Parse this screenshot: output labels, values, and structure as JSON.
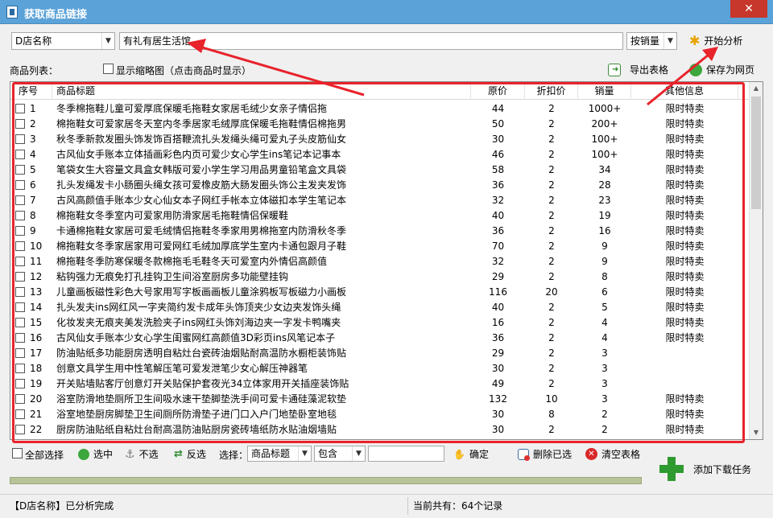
{
  "window": {
    "title": "获取商品链接",
    "close_glyph": "✕"
  },
  "search": {
    "shop_select": "D店名称",
    "keyword": "有礼有居生活馆",
    "sort_select": "按销量",
    "start_button": "开始分析"
  },
  "toolbar": {
    "list_label": "商品列表：",
    "thumb_checkbox_label": "显示缩略图（点击商品时显示）",
    "export_button": "导出表格",
    "save_web_button": "保存为网页"
  },
  "table": {
    "headers": [
      "序号",
      "商品标题",
      "原价",
      "折扣价",
      "销量",
      "其他信息"
    ],
    "rows": [
      [
        "1",
        "冬季棉拖鞋儿童可爱厚底保暖毛拖鞋女家居毛绒少女亲子情侣拖",
        "44",
        "2",
        "1000+",
        "限时特卖"
      ],
      [
        "2",
        "棉拖鞋女可爱家居冬天室内冬季居家毛绒厚底保暖毛拖鞋情侣棉拖男",
        "50",
        "2",
        "200+",
        "限时特卖"
      ],
      [
        "3",
        "秋冬季新款发圈头饰发饰百搭鞭流扎头发绳头绳可爱丸子头皮筋仙女",
        "30",
        "2",
        "100+",
        "限时特卖"
      ],
      [
        "4",
        "古风仙女手账本立体插画彩色内页可爱少女心学生ins笔记本记事本",
        "46",
        "2",
        "100+",
        "限时特卖"
      ],
      [
        "5",
        "笔袋女生大容量文具盒女韩版可爱小学生学习用品男童铅笔盒文具袋",
        "58",
        "2",
        "34",
        "限时特卖"
      ],
      [
        "6",
        "扎头发绳发卡小肠圈头绳女孩可爱橡皮筋大肠发圈头饰公主发夹发饰",
        "36",
        "2",
        "28",
        "限时特卖"
      ],
      [
        "7",
        "古风高颜值手账本少女心仙女本子网红手帐本立体磁扣本学生笔记本",
        "32",
        "2",
        "23",
        "限时特卖"
      ],
      [
        "8",
        "棉拖鞋女冬季室内可爱家用防滑家居毛拖鞋情侣保暖鞋",
        "40",
        "2",
        "19",
        "限时特卖"
      ],
      [
        "9",
        "卡通棉拖鞋女家居可爱毛绒情侣拖鞋冬季家用男棉拖室内防滑秋冬季",
        "36",
        "2",
        "16",
        "限时特卖"
      ],
      [
        "10",
        "棉拖鞋女冬季家居家用可爱网红毛绒加厚底学生室内卡通包跟月子鞋",
        "70",
        "2",
        "9",
        "限时特卖"
      ],
      [
        "11",
        "棉拖鞋冬季防寒保暖冬款棉拖毛毛鞋冬天可爱室内外情侣高颜值",
        "32",
        "2",
        "9",
        "限时特卖"
      ],
      [
        "12",
        "粘钩强力无痕免打孔挂钩卫生间浴室厨房多功能壁挂钩",
        "29",
        "2",
        "8",
        "限时特卖"
      ],
      [
        "13",
        "儿童画板磁性彩色大号家用写字板画画板儿童涂鸦板写板磁力小画板",
        "116",
        "20",
        "6",
        "限时特卖"
      ],
      [
        "14",
        "扎头发夫ins网红风一字夹简约发卡成年头饰顶夹少女边夹发饰头绳",
        "40",
        "2",
        "5",
        "限时特卖"
      ],
      [
        "15",
        "化妆发夹无痕夹美发洗脸夹子ins网红头饰刘海边夹一字发卡鸭嘴夹",
        "16",
        "2",
        "4",
        "限时特卖"
      ],
      [
        "16",
        "古风仙女手账本少女心学生闺蜜网红高颜值3D彩页ins风笔记本子",
        "36",
        "2",
        "4",
        "限时特卖"
      ],
      [
        "17",
        "防油贴纸多功能厨房透明自粘灶台瓷砖油烟贴耐高温防水橱柜装饰贴",
        "29",
        "2",
        "3",
        ""
      ],
      [
        "18",
        "创意文具学生用中性笔解压笔可爱发泄笔少女心解压神器笔",
        "30",
        "2",
        "3",
        ""
      ],
      [
        "19",
        "开关贴墙贴客厅创意灯开关贴保护套夜光34立体家用开关插座装饰贴",
        "49",
        "2",
        "3",
        ""
      ],
      [
        "20",
        "浴室防滑地垫厕所卫生间吸水速干垫脚垫洗手间可爱卡通硅藻泥软垫",
        "132",
        "10",
        "3",
        "限时特卖"
      ],
      [
        "21",
        "浴室地垫厨房脚垫卫生间厕所防滑垫子进门口入户门地垫卧室地毯",
        "30",
        "8",
        "2",
        "限时特卖"
      ],
      [
        "22",
        "厨房防油贴纸自粘灶台耐高温防油贴厨房瓷砖墙纸防水贴油烟墙贴",
        "30",
        "2",
        "2",
        "限时特卖"
      ]
    ]
  },
  "bottom": {
    "select_all": "全部选择",
    "select_button": "选中",
    "deselect_button": "不选",
    "invert_button": "反选",
    "choose_label": "选择：",
    "field_select": "商品标题",
    "mode_select": "包含",
    "filter_value": "",
    "confirm_button": "确定",
    "delete_selected_button": "删除已选",
    "clear_table_button": "清空表格",
    "add_download_button": "添加下载任务"
  },
  "status": {
    "left": "【D店名称】已分析完成",
    "right": "当前共有：64个记录"
  },
  "colors": {
    "accent_red": "#e8232b",
    "title_blue": "#5aa2d8",
    "close_red": "#c7372c"
  }
}
